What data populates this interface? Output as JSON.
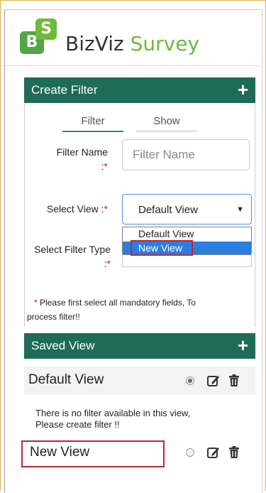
{
  "app": {
    "logo_b": "B",
    "logo_s": "S",
    "brand_part1": "BizViz",
    "brand_part2": "Survey"
  },
  "create_filter": {
    "title": "Create Filter",
    "add_icon": "plus-icon",
    "tabs": [
      {
        "label": "Filter",
        "active": true
      },
      {
        "label": "Show",
        "active": false
      }
    ],
    "filter_name_label": "Filter Name",
    "filter_name_placeholder": "Filter Name",
    "select_view_label": "Select View :",
    "select_view_value": "Default View",
    "select_view_options": [
      "Default View",
      "New View"
    ],
    "select_view_highlighted": "New View",
    "select_filter_type_label": "Select Filter Type",
    "required_mark": "*",
    "note_line1": "Please first select all mandatory fields, To",
    "note_line2": "process filter!!"
  },
  "saved_view": {
    "title": "Saved View",
    "add_icon": "plus-icon",
    "views": [
      {
        "name": "Default View",
        "selected": true,
        "message_line1": "There is no filter available in this view,",
        "message_line2": "Please create filter !!"
      },
      {
        "name": "New View",
        "selected": false
      }
    ]
  },
  "colors": {
    "header_bg": "#1e6b58",
    "accent_green": "#6dbb3a",
    "required_red": "#d0142c",
    "highlight_box": "#c1272d",
    "dropdown_selected": "#2b7ee0"
  }
}
